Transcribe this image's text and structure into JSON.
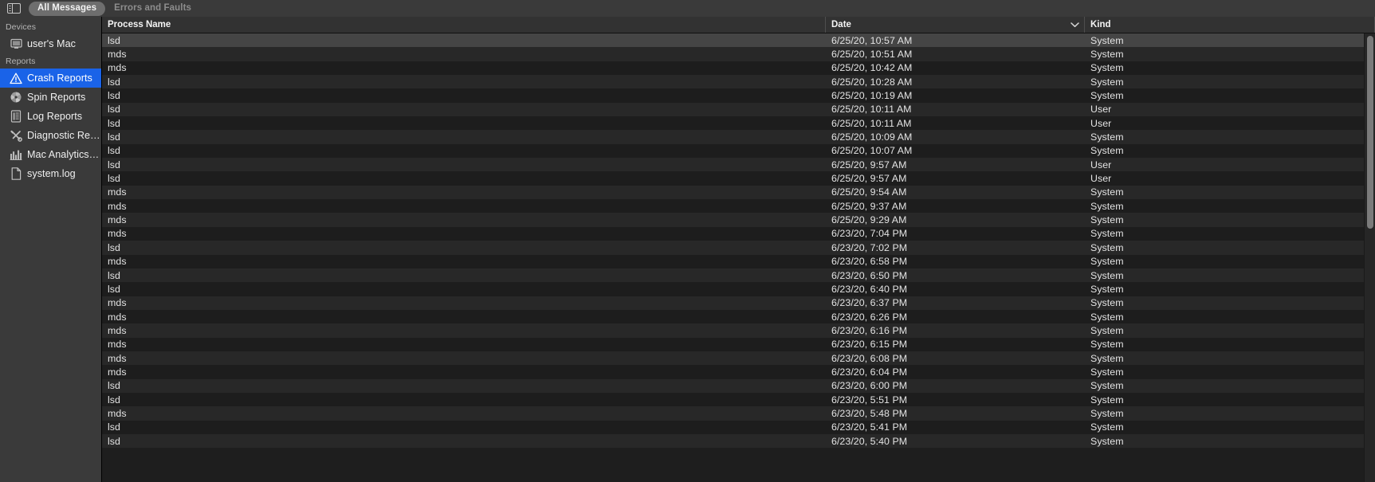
{
  "app": {
    "name": "Console"
  },
  "toolbar": {
    "sidebar_toggle_icon": "sidebar-toggle-icon",
    "segments": [
      {
        "label": "All Messages",
        "active": true
      },
      {
        "label": "Errors and Faults",
        "active": false
      }
    ]
  },
  "sidebar": {
    "groups": [
      {
        "title": "Devices",
        "items": [
          {
            "label": "user's Mac",
            "icon": "display-icon",
            "selected": false
          }
        ]
      },
      {
        "title": "Reports",
        "items": [
          {
            "label": "Crash Reports",
            "icon": "warning-triangle-icon",
            "selected": true
          },
          {
            "label": "Spin Reports",
            "icon": "spinner-pinwheel-icon",
            "selected": false
          },
          {
            "label": "Log Reports",
            "icon": "document-lines-icon",
            "selected": false
          },
          {
            "label": "Diagnostic Re…",
            "icon": "tools-icon",
            "selected": false
          },
          {
            "label": "Mac Analytics…",
            "icon": "bar-chart-icon",
            "selected": false
          },
          {
            "label": "system.log",
            "icon": "file-icon",
            "selected": false
          }
        ]
      }
    ]
  },
  "table": {
    "columns": [
      {
        "key": "process",
        "label": "Process Name",
        "sorted": false
      },
      {
        "key": "date",
        "label": "Date",
        "sorted": true,
        "sort_icon": "chevron-down-icon"
      },
      {
        "key": "kind",
        "label": "Kind",
        "sorted": false
      }
    ],
    "rows": [
      {
        "process": "lsd",
        "date": "6/25/20, 10:57 AM",
        "kind": "System",
        "selected": true
      },
      {
        "process": "mds",
        "date": "6/25/20, 10:51 AM",
        "kind": "System"
      },
      {
        "process": "mds",
        "date": "6/25/20, 10:42 AM",
        "kind": "System"
      },
      {
        "process": "lsd",
        "date": "6/25/20, 10:28 AM",
        "kind": "System"
      },
      {
        "process": "lsd",
        "date": "6/25/20, 10:19 AM",
        "kind": "System"
      },
      {
        "process": "lsd",
        "date": "6/25/20, 10:11 AM",
        "kind": "User"
      },
      {
        "process": "lsd",
        "date": "6/25/20, 10:11 AM",
        "kind": "User"
      },
      {
        "process": "lsd",
        "date": "6/25/20, 10:09 AM",
        "kind": "System"
      },
      {
        "process": "lsd",
        "date": "6/25/20, 10:07 AM",
        "kind": "System"
      },
      {
        "process": "lsd",
        "date": "6/25/20, 9:57 AM",
        "kind": "User"
      },
      {
        "process": "lsd",
        "date": "6/25/20, 9:57 AM",
        "kind": "User"
      },
      {
        "process": "mds",
        "date": "6/25/20, 9:54 AM",
        "kind": "System"
      },
      {
        "process": "mds",
        "date": "6/25/20, 9:37 AM",
        "kind": "System"
      },
      {
        "process": "mds",
        "date": "6/25/20, 9:29 AM",
        "kind": "System"
      },
      {
        "process": "mds",
        "date": "6/23/20, 7:04 PM",
        "kind": "System"
      },
      {
        "process": "lsd",
        "date": "6/23/20, 7:02 PM",
        "kind": "System"
      },
      {
        "process": "mds",
        "date": "6/23/20, 6:58 PM",
        "kind": "System"
      },
      {
        "process": "lsd",
        "date": "6/23/20, 6:50 PM",
        "kind": "System"
      },
      {
        "process": "lsd",
        "date": "6/23/20, 6:40 PM",
        "kind": "System"
      },
      {
        "process": "mds",
        "date": "6/23/20, 6:37 PM",
        "kind": "System"
      },
      {
        "process": "mds",
        "date": "6/23/20, 6:26 PM",
        "kind": "System"
      },
      {
        "process": "mds",
        "date": "6/23/20, 6:16 PM",
        "kind": "System"
      },
      {
        "process": "mds",
        "date": "6/23/20, 6:15 PM",
        "kind": "System"
      },
      {
        "process": "mds",
        "date": "6/23/20, 6:08 PM",
        "kind": "System"
      },
      {
        "process": "mds",
        "date": "6/23/20, 6:04 PM",
        "kind": "System"
      },
      {
        "process": "lsd",
        "date": "6/23/20, 6:00 PM",
        "kind": "System"
      },
      {
        "process": "lsd",
        "date": "6/23/20, 5:51 PM",
        "kind": "System"
      },
      {
        "process": "mds",
        "date": "6/23/20, 5:48 PM",
        "kind": "System"
      },
      {
        "process": "lsd",
        "date": "6/23/20, 5:41 PM",
        "kind": "System"
      },
      {
        "process": "lsd",
        "date": "6/23/20, 5:40 PM",
        "kind": "System"
      }
    ]
  },
  "scrollbar": {
    "orientation": "vertical",
    "thumb_fraction": 0.43
  },
  "colors": {
    "selection_blue": "#1a63e8",
    "toolbar_bg": "#3a3a3a",
    "row_odd": "#1d1d1d",
    "row_even": "#282828",
    "row_selected": "#454545",
    "header_bg": "#323232"
  }
}
